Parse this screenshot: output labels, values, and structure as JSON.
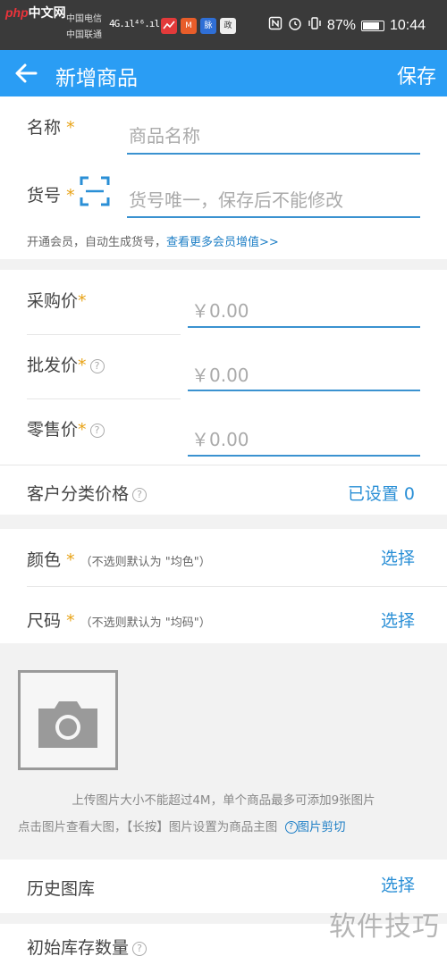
{
  "status_bar": {
    "logo_php": "php",
    "logo_cn": "中文网",
    "carrier1": "中国电信",
    "carrier2": "中国联通",
    "signal1": "4G.ıl",
    "signal2": "⁴⁶.ıl",
    "app_icon_2": "M",
    "app_icon_3": "脉",
    "app_icon_4": "政",
    "battery_percent": "87%",
    "battery_level": 0.87,
    "time": "10:44"
  },
  "app_bar": {
    "title": "新增商品",
    "save_label": "保存",
    "color": "#2a9df4"
  },
  "basic": {
    "name_label": "名称",
    "name_placeholder": "商品名称",
    "sku_label": "货号",
    "sku_placeholder": "货号唯一，保存后不能修改",
    "member_note": "开通会员，自动生成货号，",
    "member_link": "查看更多会员增值>>"
  },
  "prices": {
    "purchase_label": "采购价",
    "purchase_value": "￥0.00",
    "wholesale_label": "批发价",
    "wholesale_value": "￥0.00",
    "retail_label": "零售价",
    "retail_value": "￥0.00",
    "customer_class_label": "客户分类价格",
    "customer_class_value": "已设置 0"
  },
  "attributes": {
    "color_label": "颜色",
    "color_note": "（不选则默认为 \"均色\"）",
    "color_action": "选择",
    "size_label": "尺码",
    "size_note": "（不选则默认为 \"均码\"）",
    "size_action": "选择"
  },
  "images": {
    "upload_hint_1": "上传图片大小不能超过4M，单个商品最多可添加9张图片",
    "upload_hint_2": "点击图片查看大图，【长按】图片设置为商品主图",
    "crop_link": "图片剪切"
  },
  "history": {
    "label": "历史图库",
    "action": "选择"
  },
  "stock": {
    "label": "初始库存数量"
  },
  "watermark": "软件技巧",
  "required_mark": "*",
  "question_mark": "?"
}
